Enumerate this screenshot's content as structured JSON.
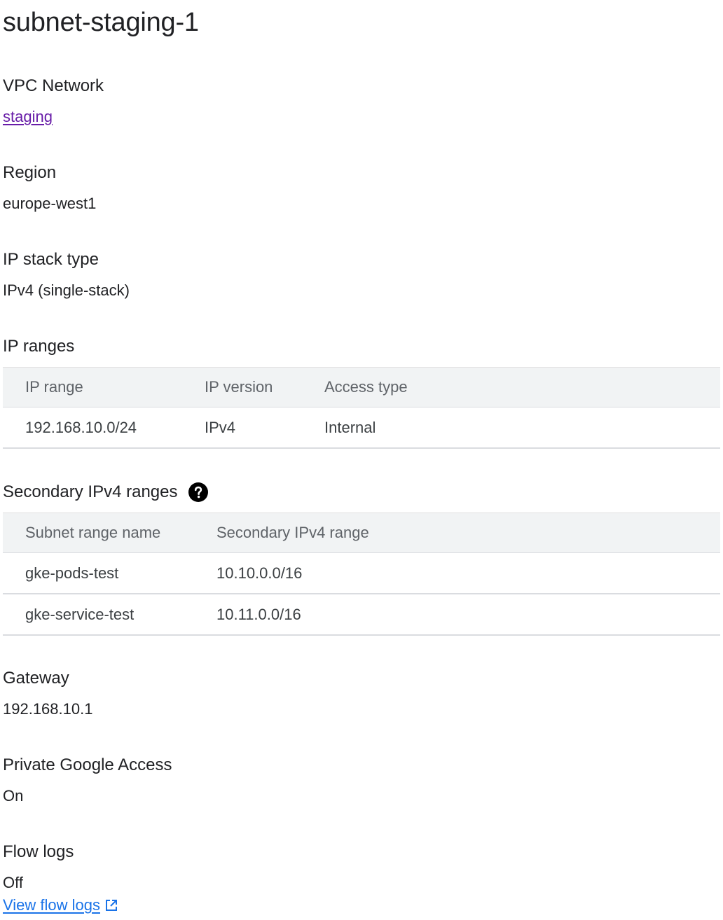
{
  "title": "subnet-staging-1",
  "vpc_network": {
    "label": "VPC Network",
    "value": "staging"
  },
  "region": {
    "label": "Region",
    "value": "europe-west1"
  },
  "ip_stack_type": {
    "label": "IP stack type",
    "value": "IPv4 (single-stack)"
  },
  "ip_ranges": {
    "label": "IP ranges",
    "headers": [
      "IP range",
      "IP version",
      "Access type"
    ],
    "rows": [
      [
        "192.168.10.0/24",
        "IPv4",
        "Internal"
      ]
    ]
  },
  "secondary_ranges": {
    "label": "Secondary IPv4 ranges",
    "help_icon": "help-circle-icon",
    "headers": [
      "Subnet range name",
      "Secondary IPv4 range"
    ],
    "rows": [
      [
        "gke-pods-test",
        "10.10.0.0/16"
      ],
      [
        "gke-service-test",
        "10.11.0.0/16"
      ]
    ]
  },
  "gateway": {
    "label": "Gateway",
    "value": "192.168.10.1"
  },
  "private_google_access": {
    "label": "Private Google Access",
    "value": "On"
  },
  "flow_logs": {
    "label": "Flow logs",
    "value": "Off",
    "link_label": "View flow logs",
    "link_icon": "open-in-new-icon"
  },
  "colors": {
    "visited_link": "#681da8",
    "link": "#1a73e8",
    "table_header_bg": "#f1f3f4",
    "divider": "#dadce0"
  }
}
